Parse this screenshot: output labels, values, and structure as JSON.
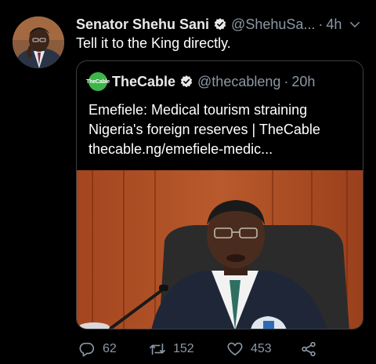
{
  "tweet": {
    "author_name": "Senator Shehu Sani",
    "handle": "@ShehuSa...",
    "separator": "·",
    "time": "4h",
    "text": "Tell it to the King directly."
  },
  "quote": {
    "logo_text": "TheCable",
    "author_name": "TheCable",
    "handle": "@thecableng",
    "separator": "·",
    "time": "20h",
    "headline_line1": "Emefiele: Medical tourism straining",
    "headline_line2": "Nigeria's foreign reserves | TheCable",
    "link": "thecable.ng/emefiele-medic..."
  },
  "actions": {
    "replies": "62",
    "retweets": "152",
    "likes": "453"
  },
  "icons": {
    "verified": "verified-badge-icon",
    "more": "chevron-down-icon",
    "reply": "reply-icon",
    "retweet": "retweet-icon",
    "like": "heart-icon",
    "share": "share-icon"
  },
  "colors": {
    "background": "#000000",
    "text": "#e7e9ea",
    "muted": "#8b98a5",
    "border": "#3a3f44",
    "brand_green": "#3db54a"
  }
}
